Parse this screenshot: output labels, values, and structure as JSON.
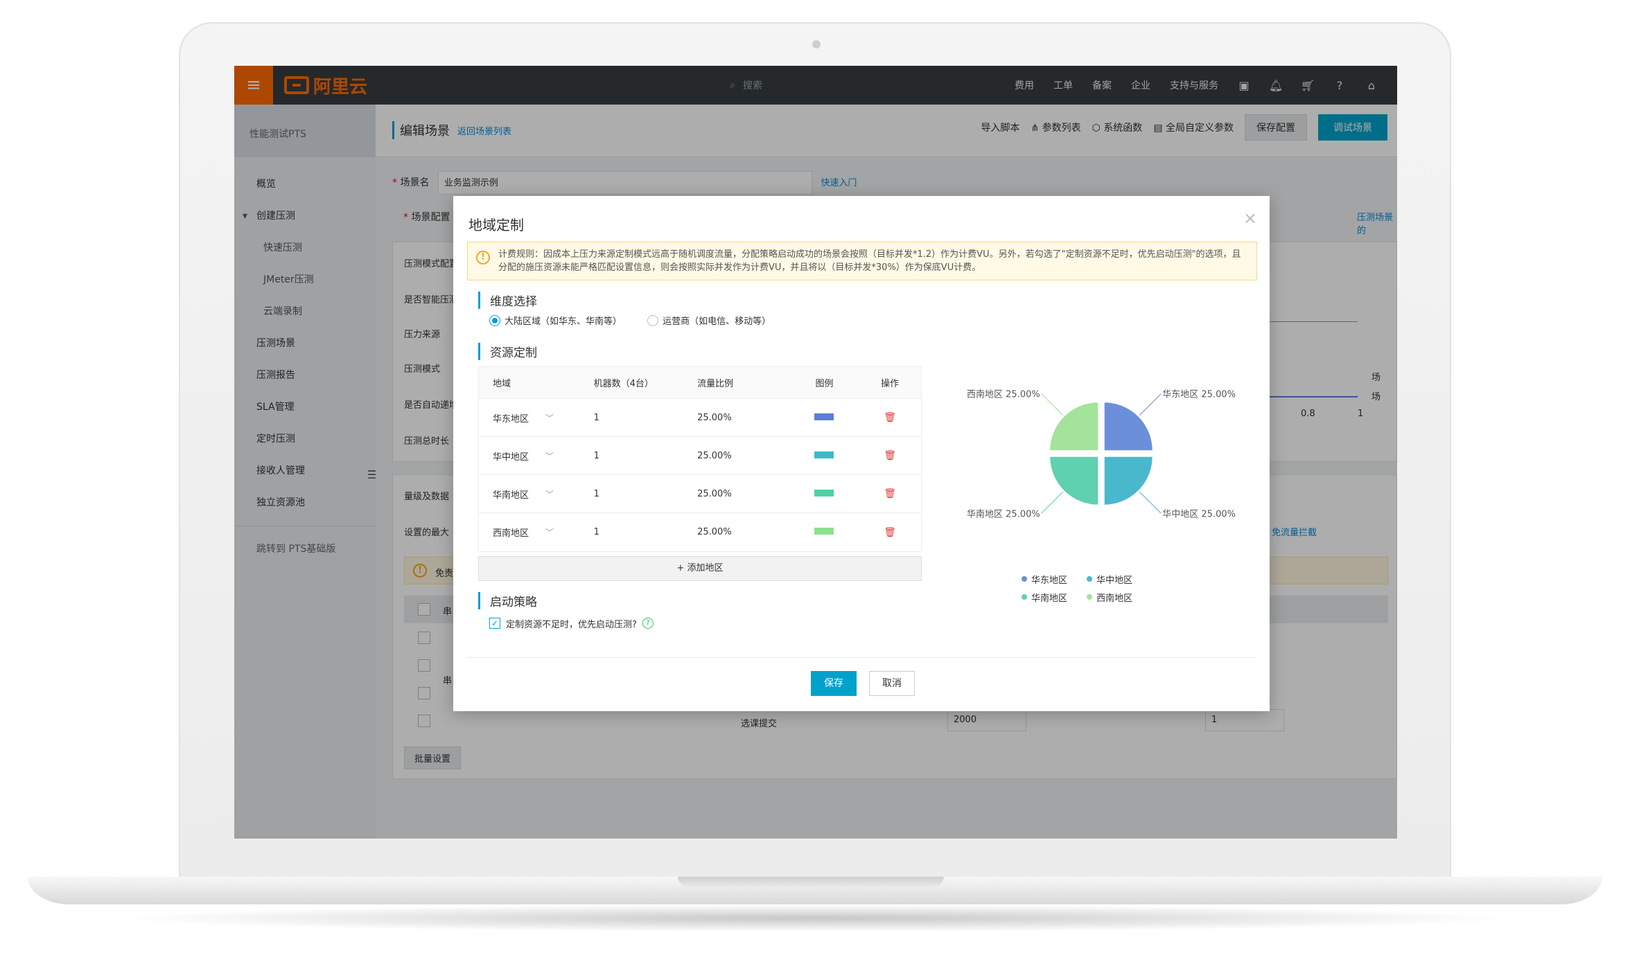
{
  "topbar": {
    "search_placeholder": "搜索",
    "nav": [
      "费用",
      "工单",
      "备案",
      "企业",
      "支持与服务"
    ]
  },
  "sidebar": {
    "title": "性能测试PTS",
    "items": [
      {
        "label": "概览",
        "sub": false
      },
      {
        "label": "创建压测",
        "sub": false,
        "caret": true
      },
      {
        "label": "快速压测",
        "sub": true
      },
      {
        "label": "JMeter压测",
        "sub": true
      },
      {
        "label": "云端录制",
        "sub": true
      },
      {
        "label": "压测场景",
        "sub": false
      },
      {
        "label": "压测报告",
        "sub": false
      },
      {
        "label": "SLA管理",
        "sub": false
      },
      {
        "label": "定时压测",
        "sub": false
      },
      {
        "label": "接收人管理",
        "sub": false
      },
      {
        "label": "独立资源池",
        "sub": false
      }
    ],
    "footer_link": "跳转到 PTS基础版"
  },
  "page": {
    "title": "编辑场景",
    "back_link": "返回场景列表",
    "actions": [
      "导入脚本",
      "参数列表",
      "系统函数",
      "全局自定义参数"
    ],
    "save_config": "保存配置",
    "debug_scene": "调试场景",
    "scene_name_label": "场景名",
    "scene_name_value": "业务监测示例",
    "quick_start": "快速入门",
    "scene_config_label": "场景配置",
    "scene_config_right": "压测场景的",
    "left_labels": [
      "压测模式配置",
      "是否智能压测",
      "压力来源",
      "压测模式",
      "是否自动递增",
      "压测总时长"
    ],
    "chart_ticks": [
      "0.8",
      "1"
    ],
    "chart_legend": [
      "场",
      "场"
    ],
    "section2_label": "量级及数据",
    "max_label": "设置的最大",
    "free_traffic_link": "免流量拦截",
    "notice_short": "免责",
    "table_head_short": "串",
    "table_row_short": "串",
    "row_label": "选课提交",
    "row_value_1": "2000",
    "row_value_2": "1",
    "batch_button": "批量设置"
  },
  "modal": {
    "title": "地域定制",
    "notice": "计费规则：因成本上压力来源定制模式远高于随机调度流量，分配策略启动成功的场景会按照（目标并发*1.2）作为计费VU。另外，若勾选了\"定制资源不足时，优先启动压测\"的选项，且分配的施压资源未能严格匹配设置信息，则会按照实际并发作为计费VU，并且将以（目标并发*30%）作为保底VU计费。",
    "dimension_title": "维度选择",
    "radio_region": "大陆区域（如华东、华南等）",
    "radio_isp": "运营商（如电信、移动等）",
    "resource_title": "资源定制",
    "table_headers": [
      "地域",
      "机器数（4台）",
      "流量比例",
      "图例",
      "操作"
    ],
    "rows": [
      {
        "region": "华东地区",
        "machines": "1",
        "ratio": "25.00%",
        "color": "#5b7fd6"
      },
      {
        "region": "华中地区",
        "machines": "1",
        "ratio": "25.00%",
        "color": "#3db8cb"
      },
      {
        "region": "华南地区",
        "machines": "1",
        "ratio": "25.00%",
        "color": "#4fd1a5"
      },
      {
        "region": "西南地区",
        "machines": "1",
        "ratio": "25.00%",
        "color": "#8ee08e"
      }
    ],
    "add_region": "+ 添加地区",
    "strategy_title": "启动策略",
    "strategy_checkbox": "定制资源不足时，优先启动压测?",
    "save": "保存",
    "cancel": "取消"
  },
  "chart_data": {
    "type": "pie",
    "labels": [
      "华东地区",
      "华中地区",
      "华南地区",
      "西南地区"
    ],
    "values": [
      25.0,
      25.0,
      25.0,
      25.0
    ],
    "value_labels": [
      "华东地区 25.00%",
      "华中地区 25.00%",
      "华南地区 25.00%",
      "西南地区 25.00%"
    ],
    "colors": [
      "#6b8fd9",
      "#4ab8cc",
      "#5fd0b0",
      "#a3e39a"
    ],
    "legend": [
      "华东地区",
      "华中地区",
      "华南地区",
      "西南地区"
    ]
  }
}
